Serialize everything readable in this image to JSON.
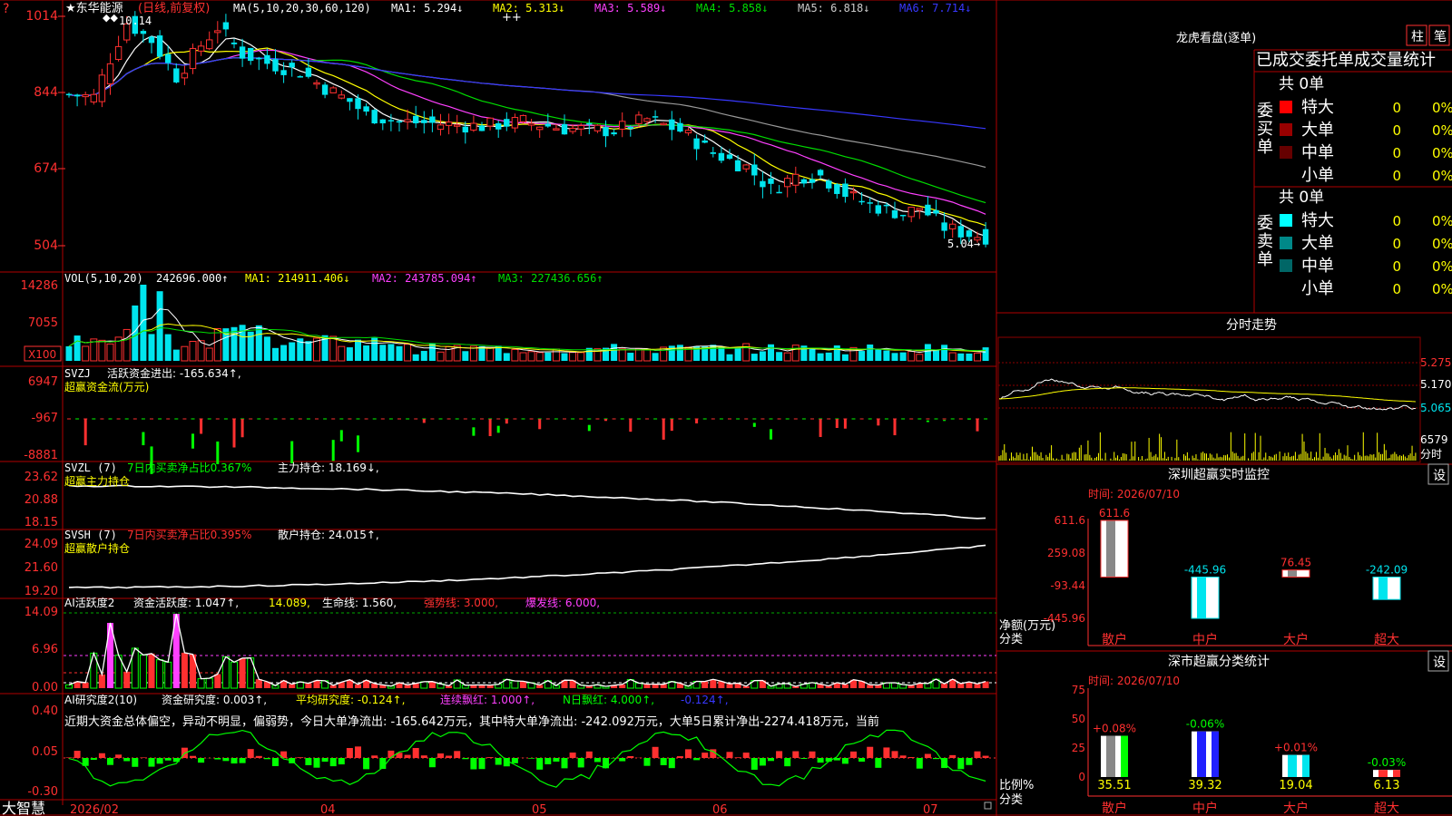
{
  "colors": {
    "up": "#ff3030",
    "down": "#00e5ee",
    "ma1": "#ffffff",
    "ma2": "#ffff00",
    "ma3": "#ff40ff",
    "ma4": "#00dd00",
    "ma5": "#999999",
    "ma6": "#3838ff",
    "grid": "#a00000",
    "label_red": "#ff3030",
    "green": "#00ff00"
  },
  "main": {
    "stock": "★东华能源",
    "mode": "(日线,前复权)",
    "ma_spec": "MA(5,10,20,30,60,120)",
    "mas": [
      {
        "label": "MA1: 5.294↓",
        "color": "#ffffff"
      },
      {
        "label": "MA2: 5.313↓",
        "color": "#ffff00"
      },
      {
        "label": "MA3: 5.589↓",
        "color": "#ff40ff"
      },
      {
        "label": "MA4: 5.858↓",
        "color": "#00dd00"
      },
      {
        "label": "MA5: 6.818↓",
        "color": "#cccccc"
      },
      {
        "label": "MA6: 7.714↓",
        "color": "#3838ff"
      }
    ],
    "high_note": "10.14",
    "low_note": "5.04→",
    "axis": [
      "1014",
      "844",
      "674",
      "504"
    ],
    "marker": "++"
  },
  "vol": {
    "title": "VOL(5,10,20)",
    "value": "242696.000↑",
    "ma1": "MA1: 214911.406↓",
    "ma2": "MA2: 243785.094↑",
    "ma3": "MA3: 227436.656↑",
    "axis": [
      "14286",
      "7055"
    ],
    "unit": "X100"
  },
  "svzj": {
    "title": "SVZJ",
    "label": "活跃资金进出: -165.634↑,",
    "subtitle": "超赢资金流(万元)",
    "axis": [
      "6947",
      "-967",
      "-8881"
    ]
  },
  "svzl": {
    "title": "SVZL (7)",
    "ratio": "7日内买卖净占比0.367%",
    "hold": "主力持仓: 18.169↓,",
    "subtitle": "超赢主力持仓",
    "axis": [
      "23.62",
      "20.88",
      "18.15"
    ]
  },
  "svsh": {
    "title": "SVSH (7)",
    "ratio": "7日内买卖净占比0.395%",
    "hold": "散户持仓: 24.015↑,",
    "subtitle": "超赢散户持仓",
    "axis": [
      "24.09",
      "21.60",
      "19.20"
    ]
  },
  "ai1": {
    "title": "AI活跃度2",
    "v1": "资金活跃度: 1.047↑,",
    "v2": "14.089,",
    "v3": "生命线: 1.560,",
    "v4": "强势线: 3.000,",
    "v5": "爆发线: 6.000,",
    "axis": [
      "14.09",
      "6.96",
      "0.00"
    ]
  },
  "ai2": {
    "title": "AI研究度2(10)",
    "v1": "资金研究度: 0.003↑,",
    "v2": "平均研究度: -0.124↑,",
    "v3": "连续飘红: 1.000↑,",
    "v4": "N日飘红: 4.000↑,",
    "v5": "-0.124↑,",
    "desc": "近期大资金总体偏空，异动不明显，偏弱势，今日大单净流出: -165.642万元，其中特大单净流出: -242.092万元，大单5日累计净出-2274.418万元，当前",
    "axis": [
      "0.40",
      "0.05",
      "-0.30"
    ]
  },
  "xaxis": {
    "brand": "大智慧",
    "dates": [
      "2026/02",
      "04",
      "05",
      "06",
      "07"
    ]
  },
  "right": {
    "tabs": [
      "柱",
      "笔"
    ],
    "lhb_title": "龙虎看盘(逐单)",
    "lhb_sub": "已成交委托单成交量统计",
    "buy_label": "委买单",
    "sell_label": "委卖单",
    "total_buy": "共 0单",
    "total_sell": "共 0单",
    "buy_rows": [
      {
        "name": "特大",
        "count": "0",
        "pct": "0%",
        "color": "#ff0000"
      },
      {
        "name": "大单",
        "count": "0",
        "pct": "0%",
        "color": "#990000"
      },
      {
        "name": "中单",
        "count": "0",
        "pct": "0%",
        "color": "#660000"
      },
      {
        "name": "小单",
        "count": "0",
        "pct": "0%",
        "color": ""
      }
    ],
    "sell_rows": [
      {
        "name": "特大",
        "count": "0",
        "pct": "0%",
        "color": "#00ffff"
      },
      {
        "name": "大单",
        "count": "0",
        "pct": "0%",
        "color": "#008888"
      },
      {
        "name": "中单",
        "count": "0",
        "pct": "0%",
        "color": "#006666"
      },
      {
        "name": "小单",
        "count": "0",
        "pct": "0%",
        "color": ""
      }
    ],
    "intraday_title": "分时走势",
    "intraday_axis": [
      "5.275",
      "5.170",
      "5.065"
    ],
    "intraday_vol": "6579",
    "intraday_unit": "分时",
    "monitor_title": "深圳超赢实时监控",
    "monitor_set": "设",
    "monitor_time": "时间: 2026/07/10",
    "monitor_axis": [
      "611.6",
      "259.08",
      "-93.44",
      "-445.96"
    ],
    "monitor_ylabel": "净额(万元)",
    "monitor_xlabel": "分类",
    "stats_title": "深市超赢分类统计",
    "stats_set": "设",
    "stats_time": "时间: 2026/07/10",
    "stats_axis": [
      "75",
      "50",
      "25",
      "0"
    ],
    "stats_ylabel": "比例%",
    "stats_xlabel": "分类"
  },
  "chart_data": [
    {
      "type": "bar",
      "title": "深圳超赢实时监控",
      "categories": [
        "散户",
        "中户",
        "大户",
        "超大"
      ],
      "values": [
        611.6,
        -445.96,
        76.45,
        -242.09
      ],
      "value_labels": [
        "611.6",
        "-445.96",
        "76.45",
        "-242.09"
      ],
      "ylim": [
        -445.96,
        611.6
      ],
      "ylabel": "净额(万元)"
    },
    {
      "type": "bar",
      "title": "深市超赢分类统计",
      "categories": [
        "散户",
        "中户",
        "大户",
        "超大"
      ],
      "values": [
        35.51,
        39.32,
        19.04,
        6.13
      ],
      "change_labels": [
        "+0.08%",
        "-0.06%",
        "+0.01%",
        "-0.03%"
      ],
      "value_labels": [
        "35.51",
        "39.32",
        "19.04",
        "6.13"
      ],
      "ylim": [
        0,
        75
      ],
      "ylabel": "比例%"
    }
  ]
}
